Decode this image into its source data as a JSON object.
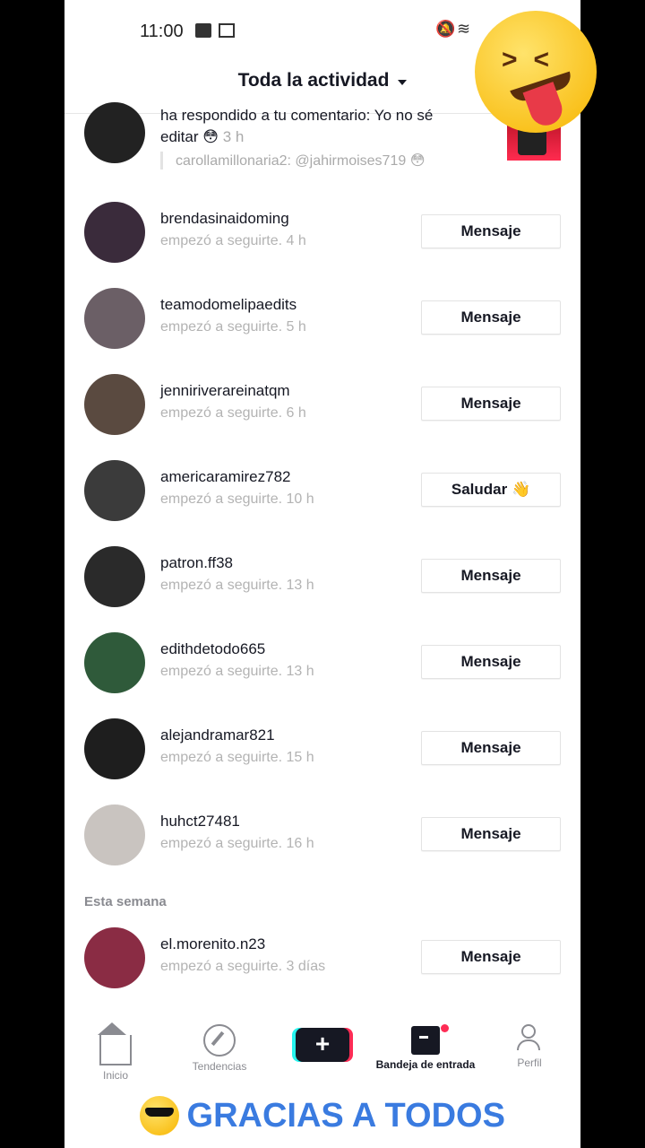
{
  "status": {
    "time": "11:00"
  },
  "header": {
    "title": "Toda la actividad"
  },
  "reply": {
    "text": "ha respondido a tu comentario: Yo no sé editar 😳",
    "time": "3 h",
    "quote": "carollamillonaria2: @jahirmoises719 😳"
  },
  "followers": [
    {
      "name": "brendasinaidoming",
      "sub": "empezó a seguirte. 4 h",
      "button": "Mensaje",
      "avatar_color": "#3a2b3b"
    },
    {
      "name": "teamodomelipaedits",
      "sub": "empezó a seguirte. 5 h",
      "button": "Mensaje",
      "avatar_color": "#6b5f66"
    },
    {
      "name": "jenniriverareinatqm",
      "sub": "empezó a seguirte. 6 h",
      "button": "Mensaje",
      "avatar_color": "#5a4a40"
    },
    {
      "name": "americaramirez782",
      "sub": "empezó a seguirte. 10 h",
      "button": "Saludar 👋",
      "avatar_color": "#3b3b3b"
    },
    {
      "name": "patron.ff38",
      "sub": "empezó a seguirte. 13 h",
      "button": "Mensaje",
      "avatar_color": "#2a2a2a"
    },
    {
      "name": "edithdetodo665",
      "sub": "empezó a seguirte. 13 h",
      "button": "Mensaje",
      "avatar_color": "#2f5a3a"
    },
    {
      "name": "alejandramar821",
      "sub": "empezó a seguirte. 15 h",
      "button": "Mensaje",
      "avatar_color": "#1e1e1e"
    },
    {
      "name": "huhct27481",
      "sub": "empezó a seguirte. 16 h",
      "button": "Mensaje",
      "avatar_color": "#c9c4c0"
    }
  ],
  "section_week": "Esta semana",
  "week_followers": [
    {
      "name": "el.morenito.n23",
      "sub": "empezó a seguirte. 3 días",
      "button": "Mensaje",
      "avatar_color": "#8a2c44"
    }
  ],
  "tabs": {
    "home": "Inicio",
    "discover": "Tendencias",
    "inbox": "Bandeja de entrada",
    "profile": "Perfil"
  },
  "banner": "GRACIAS A TODOS"
}
